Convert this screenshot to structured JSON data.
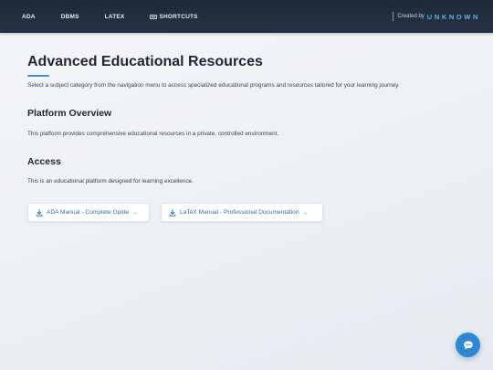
{
  "nav": {
    "items": [
      {
        "label": "ADA"
      },
      {
        "label": "DBMS"
      },
      {
        "label": "LATEX"
      },
      {
        "label": "SHORTCUTS",
        "icon": "keyboard-icon"
      }
    ],
    "credit_prefix": "Created by",
    "credit_name": "UNKNOWN"
  },
  "main": {
    "title": "Advanced Educational Resources",
    "lead": "Select a subject category from the navigation menu to access specialized educational programs and resources tailored for your learning journey.",
    "sections": [
      {
        "title": "Platform Overview",
        "text": "This platform provides comprehensive educational resources in a private, controlled environment."
      },
      {
        "title": "Access",
        "text": "This is an educational platform designed for learning excellence."
      }
    ],
    "buttons": [
      {
        "label": "ADA Manual - Complete Guide",
        "icon": "download-icon",
        "arrow": "→"
      },
      {
        "label": "LaTeX Manual - Professional Documentation",
        "icon": "download-icon",
        "arrow": "→"
      }
    ]
  },
  "chat_button": {
    "icon": "chat-bubble-icon"
  },
  "colors": {
    "topbar": "#1f2a38",
    "accent": "#4a90c8",
    "link": "#2e6fa8",
    "credit_name": "#5fb0e6",
    "fab": "#2f86d1"
  }
}
